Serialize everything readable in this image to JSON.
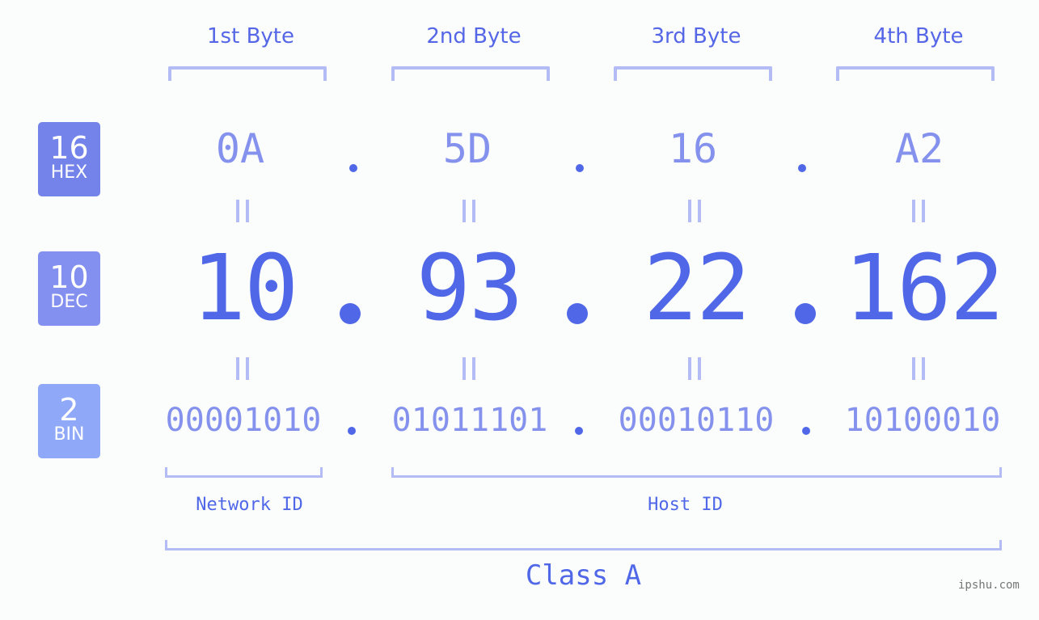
{
  "bytes": [
    {
      "label": "1st Byte",
      "hex": "0A",
      "dec": "10",
      "bin": "00001010"
    },
    {
      "label": "2nd Byte",
      "hex": "5D",
      "dec": "93",
      "bin": "01011101"
    },
    {
      "label": "3rd Byte",
      "hex": "16",
      "dec": "22",
      "bin": "00010110"
    },
    {
      "label": "4th Byte",
      "hex": "A2",
      "dec": "162",
      "bin": "10100010"
    }
  ],
  "badges": {
    "hex": {
      "number": "16",
      "label": "HEX",
      "color": "#7383ea"
    },
    "dec": {
      "number": "10",
      "label": "DEC",
      "color": "#8390ef"
    },
    "bin": {
      "number": "2",
      "label": "BIN",
      "color": "#8fa8f8"
    }
  },
  "segments": {
    "network": "Network ID",
    "host": "Host ID"
  },
  "ip_class": "Class A",
  "watermark": "ipshu.com",
  "colors": {
    "accent": "#5068e8",
    "light_accent": "#8592ed",
    "bracket": "#b3bcf5"
  }
}
